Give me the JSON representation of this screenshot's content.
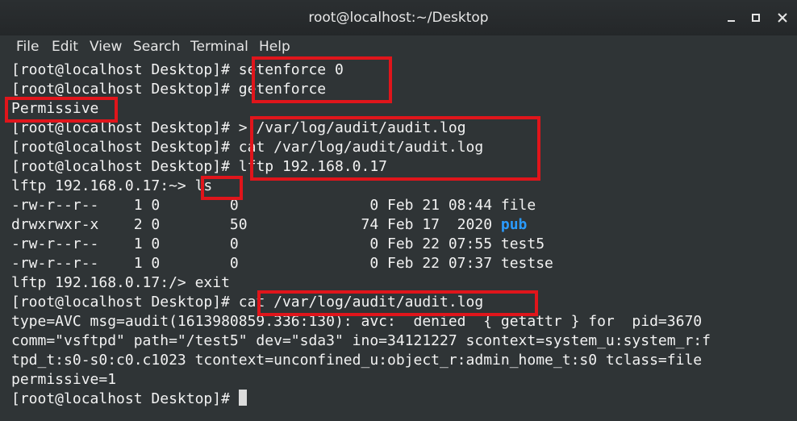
{
  "window": {
    "title": "root@localhost:~/Desktop"
  },
  "menu": [
    "File",
    "Edit",
    "View",
    "Search",
    "Terminal",
    "Help"
  ],
  "terminal_lines": [
    {
      "prompt": "[root@localhost Desktop]# ",
      "cmd": "setenforce 0"
    },
    {
      "prompt": "[root@localhost Desktop]# ",
      "cmd": "getenforce"
    },
    {
      "text": "Permissive"
    },
    {
      "prompt": "[root@localhost Desktop]# ",
      "cmd": "> /var/log/audit/audit.log"
    },
    {
      "prompt": "[root@localhost Desktop]# ",
      "cmd": "cat /var/log/audit/audit.log"
    },
    {
      "prompt": "[root@localhost Desktop]# ",
      "cmd": "lftp 192.168.0.17"
    },
    {
      "prompt": "lftp 192.168.0.17:~> ",
      "cmd": "ls"
    },
    {
      "text": "-rw-r--r--    1 0        0               0 Feb 21 08:44 file"
    },
    {
      "text": "drwxrwxr-x    2 0        50             74 Feb 17  2020 ",
      "highlight": "pub"
    },
    {
      "text": "-rw-r--r--    1 0        0               0 Feb 22 07:55 test5"
    },
    {
      "text": "-rw-r--r--    1 0        0               0 Feb 22 07:37 testse"
    },
    {
      "text": "lftp 192.168.0.17:/> exit"
    },
    {
      "prompt": "[root@localhost Desktop]# ",
      "cmd": "cat /var/log/audit/audit.log"
    },
    {
      "text": "type=AVC msg=audit(1613980859.336:130): avc:  denied  { getattr } for  pid=3670"
    },
    {
      "text": "comm=\"vsftpd\" path=\"/test5\" dev=\"sda3\" ino=34121227 scontext=system_u:system_r:f"
    },
    {
      "text": "tpd_t:s0-s0:c0.c1023 tcontext=unconfined_u:object_r:admin_home_t:s0 tclass=file"
    },
    {
      "text": "permissive=1"
    },
    {
      "prompt": "[root@localhost Desktop]# ",
      "cmd": ""
    }
  ],
  "colors": {
    "background": "#2f3436",
    "text": "#f2f2f2",
    "highlight_box": "#e0151b",
    "directory": "#2a9bff"
  }
}
